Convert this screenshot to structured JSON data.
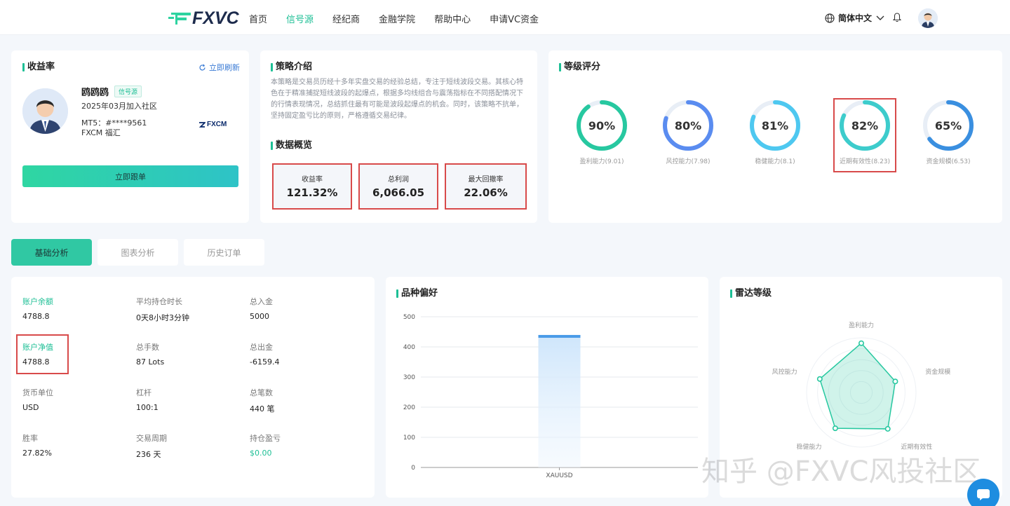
{
  "header": {
    "logo_text": "FXVC",
    "nav": [
      {
        "label": "首页",
        "active": false
      },
      {
        "label": "信号源",
        "active": true
      },
      {
        "label": "经纪商",
        "active": false
      },
      {
        "label": "金融学院",
        "active": false
      },
      {
        "label": "帮助中心",
        "active": false
      },
      {
        "label": "申请VC资金",
        "active": false
      }
    ],
    "language": "简体中文"
  },
  "profit_card": {
    "title": "收益率",
    "refresh_label": "立即刷新",
    "user_name": "鸥鸥鸥",
    "badge": "信号源",
    "joined": "2025年03月加入社区",
    "account": "MT5：#****9561",
    "broker": "FXCM 福汇",
    "broker_logo_text": "FXCM",
    "follow_button": "立即跟单"
  },
  "strategy_card": {
    "title": "策略介绍",
    "text": "本策略是交易员历经十多年实盘交易的经验总结，专注于短线波段交易。其核心特色在于精准捕捉短线波段的起爆点，根据多均线组合与震荡指标在不同搭配情况下的行情表现情况，总结抓住最有可能是波段起爆点的机会。同时，该策略不抗单，坚持固定盈亏比的原则，严格遵循交易纪律。",
    "overview_title": "数据概览",
    "stats": [
      {
        "label": "收益率",
        "value": "121.32%"
      },
      {
        "label": "总利润",
        "value": "6,066.05"
      },
      {
        "label": "最大回撤率",
        "value": "22.06%"
      }
    ]
  },
  "rating_card": {
    "title": "等级评分",
    "gauges": [
      {
        "percent": 90,
        "text": "90%",
        "label": "盈利能力(9.01)",
        "color": "#27c8a0"
      },
      {
        "percent": 80,
        "text": "80%",
        "label": "风控能力(7.98)",
        "color": "#5a8cf0"
      },
      {
        "percent": 81,
        "text": "81%",
        "label": "稳健能力(8.1)",
        "color": "#4ec8f0"
      },
      {
        "percent": 82,
        "text": "82%",
        "label": "近期有效性(8.23)",
        "color": "#3dcccc"
      },
      {
        "percent": 65,
        "text": "65%",
        "label": "资金规模(6.53)",
        "color": "#3a8fe0"
      }
    ]
  },
  "tabs": [
    {
      "label": "基础分析",
      "active": true
    },
    {
      "label": "图表分析",
      "active": false
    },
    {
      "label": "历史订单",
      "active": false
    }
  ],
  "basic": {
    "rows": [
      [
        {
          "label": "账户余额",
          "value": "4788.8",
          "highlight": true
        },
        {
          "label": "平均持仓时长",
          "value": "0天8小时3分钟"
        },
        {
          "label": "总入金",
          "value": "5000"
        }
      ],
      [
        {
          "label": "账户净值",
          "value": "4788.8",
          "highlight": true
        },
        {
          "label": "总手数",
          "value": "87 Lots"
        },
        {
          "label": "总出金",
          "value": "-6159.4"
        }
      ],
      [
        {
          "label": "货币单位",
          "value": "USD"
        },
        {
          "label": "杠杆",
          "value": "100:1"
        },
        {
          "label": "总笔数",
          "value": "440 笔"
        }
      ],
      [
        {
          "label": "胜率",
          "value": "27.82%"
        },
        {
          "label": "交易周期",
          "value": "236 天"
        },
        {
          "label": "持仓盈亏",
          "value": "$0.00",
          "value_green": true
        }
      ]
    ]
  },
  "variety_card": {
    "title": "品种偏好"
  },
  "radar_card": {
    "title": "雷达等级"
  },
  "chart_data": [
    {
      "type": "bar",
      "categories": [
        "XAUUSD"
      ],
      "values": [
        435
      ],
      "ylim": [
        0,
        500
      ],
      "yticks": [
        0,
        100,
        200,
        300,
        400,
        500
      ],
      "grid": true,
      "color": "#4a9be8"
    },
    {
      "type": "radar",
      "axes": [
        "盈利能力",
        "资金规模",
        "近期有效性",
        "稳健能力",
        "风控能力"
      ],
      "values": [
        9.01,
        6.53,
        8.23,
        8.1,
        7.98
      ],
      "max": 10,
      "color": "#27c8a0"
    }
  ],
  "watermark": "知乎 @FXVC风投社区"
}
